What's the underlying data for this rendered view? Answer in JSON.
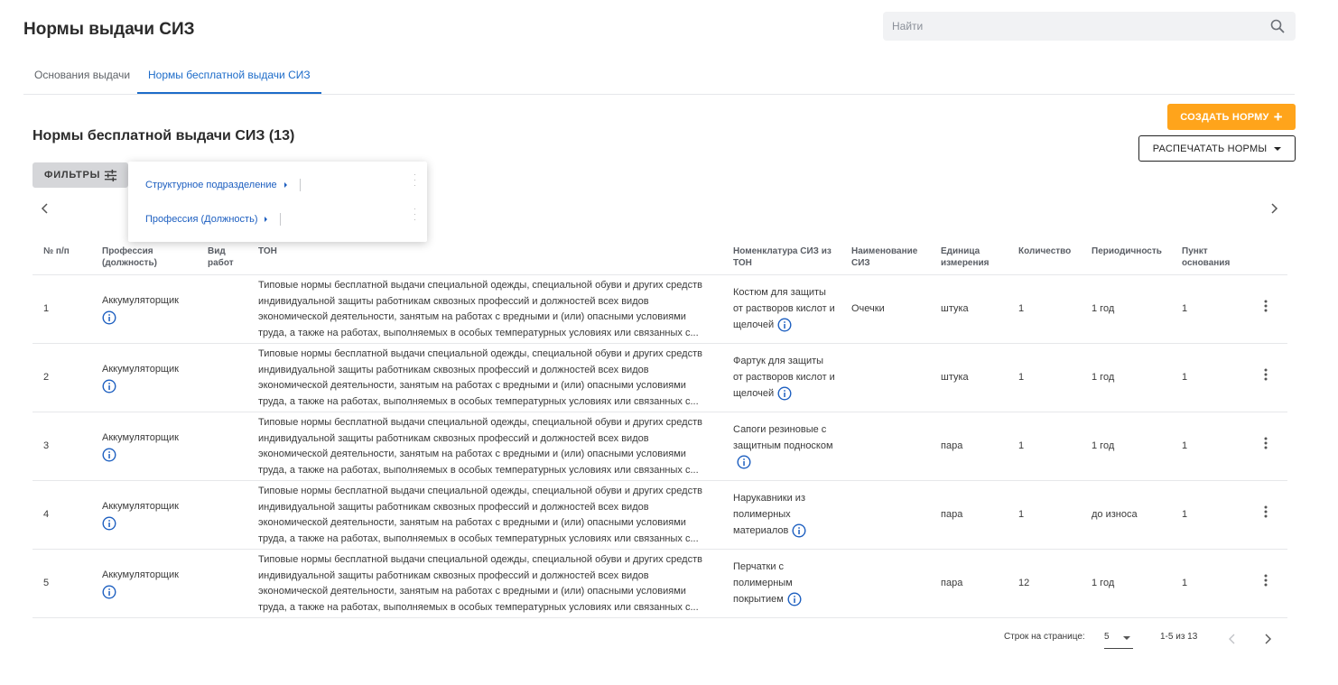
{
  "page": {
    "title": "Нормы выдачи СИЗ"
  },
  "search": {
    "placeholder": "Найти",
    "icon": "search-icon"
  },
  "tabs": [
    {
      "label": "Основания выдачи",
      "active": false
    },
    {
      "label": "Нормы бесплатной выдачи СИЗ",
      "active": true
    }
  ],
  "section": {
    "title": "Нормы бесплатной выдачи СИЗ (13)"
  },
  "actions": {
    "create_label": "СОЗДАТЬ НОРМУ",
    "create_icon": "+",
    "print_label": "РАСПЕЧАТАТЬ НОРМЫ"
  },
  "filters": {
    "button_label": "ФИЛЬТРЫ",
    "items": [
      {
        "label": "Структурное подразделение"
      },
      {
        "label": "Профессия (Должность)"
      }
    ]
  },
  "colors": {
    "accent": "#1d6cc9",
    "create_button": "#ffa41b",
    "info_icon": "#1d5fc0"
  },
  "table": {
    "headers": {
      "num": "№ п/п",
      "profession": "Профессия (должность)",
      "work_type": "Вид работ",
      "ton": "ТОН",
      "nomenclature": "Номенклатура СИЗ из ТОН",
      "name": "Наименование СИЗ",
      "unit": "Единица измерения",
      "quantity": "Количество",
      "period": "Периодичность",
      "clause": "Пункт основания"
    },
    "rows": [
      {
        "num": "1",
        "profession": "Аккумуляторщик",
        "work_type": "",
        "ton": "Типовые нормы бесплатной выдачи специальной одежды, специальной обуви и других средств индивидуальной защиты работникам сквозных профессий и должностей всех видов экономической деятельности, занятым на работах с вредными и (или) опасными условиями труда, а также на работах, выполняемых в особых температурных условиях или связанных с...",
        "nomenclature": "Костюм для защиты от растворов кислот и щелочей",
        "name": "Очечки",
        "unit": "штука",
        "quantity": "1",
        "period": "1 год",
        "clause": "1"
      },
      {
        "num": "2",
        "profession": "Аккумуляторщик",
        "work_type": "",
        "ton": "Типовые нормы бесплатной выдачи специальной одежды, специальной обуви и других средств индивидуальной защиты работникам сквозных профессий и должностей всех видов экономической деятельности, занятым на работах с вредными и (или) опасными условиями труда, а также на работах, выполняемых в особых температурных условиях или связанных с...",
        "nomenclature": "Фартук для защиты от растворов кислот и щелочей",
        "name": "",
        "unit": "штука",
        "quantity": "1",
        "period": "1 год",
        "clause": "1"
      },
      {
        "num": "3",
        "profession": "Аккумуляторщик",
        "work_type": "",
        "ton": "Типовые нормы бесплатной выдачи специальной одежды, специальной обуви и других средств индивидуальной защиты работникам сквозных профессий и должностей всех видов экономической деятельности, занятым на работах с вредными и (или) опасными условиями труда, а также на работах, выполняемых в особых температурных условиях или связанных с...",
        "nomenclature": "Сапоги резиновые с защитным подноском",
        "name": "",
        "unit": "пара",
        "quantity": "1",
        "period": "1 год",
        "clause": "1"
      },
      {
        "num": "4",
        "profession": "Аккумуляторщик",
        "work_type": "",
        "ton": "Типовые нормы бесплатной выдачи специальной одежды, специальной обуви и других средств индивидуальной защиты работникам сквозных профессий и должностей всех видов экономической деятельности, занятым на работах с вредными и (или) опасными условиями труда, а также на работах, выполняемых в особых температурных условиях или связанных с...",
        "nomenclature": "Нарукавники из полимерных материалов",
        "name": "",
        "unit": "пара",
        "quantity": "1",
        "period": "до износа",
        "clause": "1"
      },
      {
        "num": "5",
        "profession": "Аккумуляторщик",
        "work_type": "",
        "ton": "Типовые нормы бесплатной выдачи специальной одежды, специальной обуви и других средств индивидуальной защиты работникам сквозных профессий и должностей всех видов экономической деятельности, занятым на работах с вредными и (или) опасными условиями труда, а также на работах, выполняемых в особых температурных условиях или связанных с...",
        "nomenclature": "Перчатки с полимерным покрытием",
        "name": "",
        "unit": "пара",
        "quantity": "12",
        "period": "1 год",
        "clause": "1"
      }
    ]
  },
  "pagination": {
    "rows_label": "Строк на странице:",
    "rows_value": "5",
    "range": "1-5 из 13"
  }
}
